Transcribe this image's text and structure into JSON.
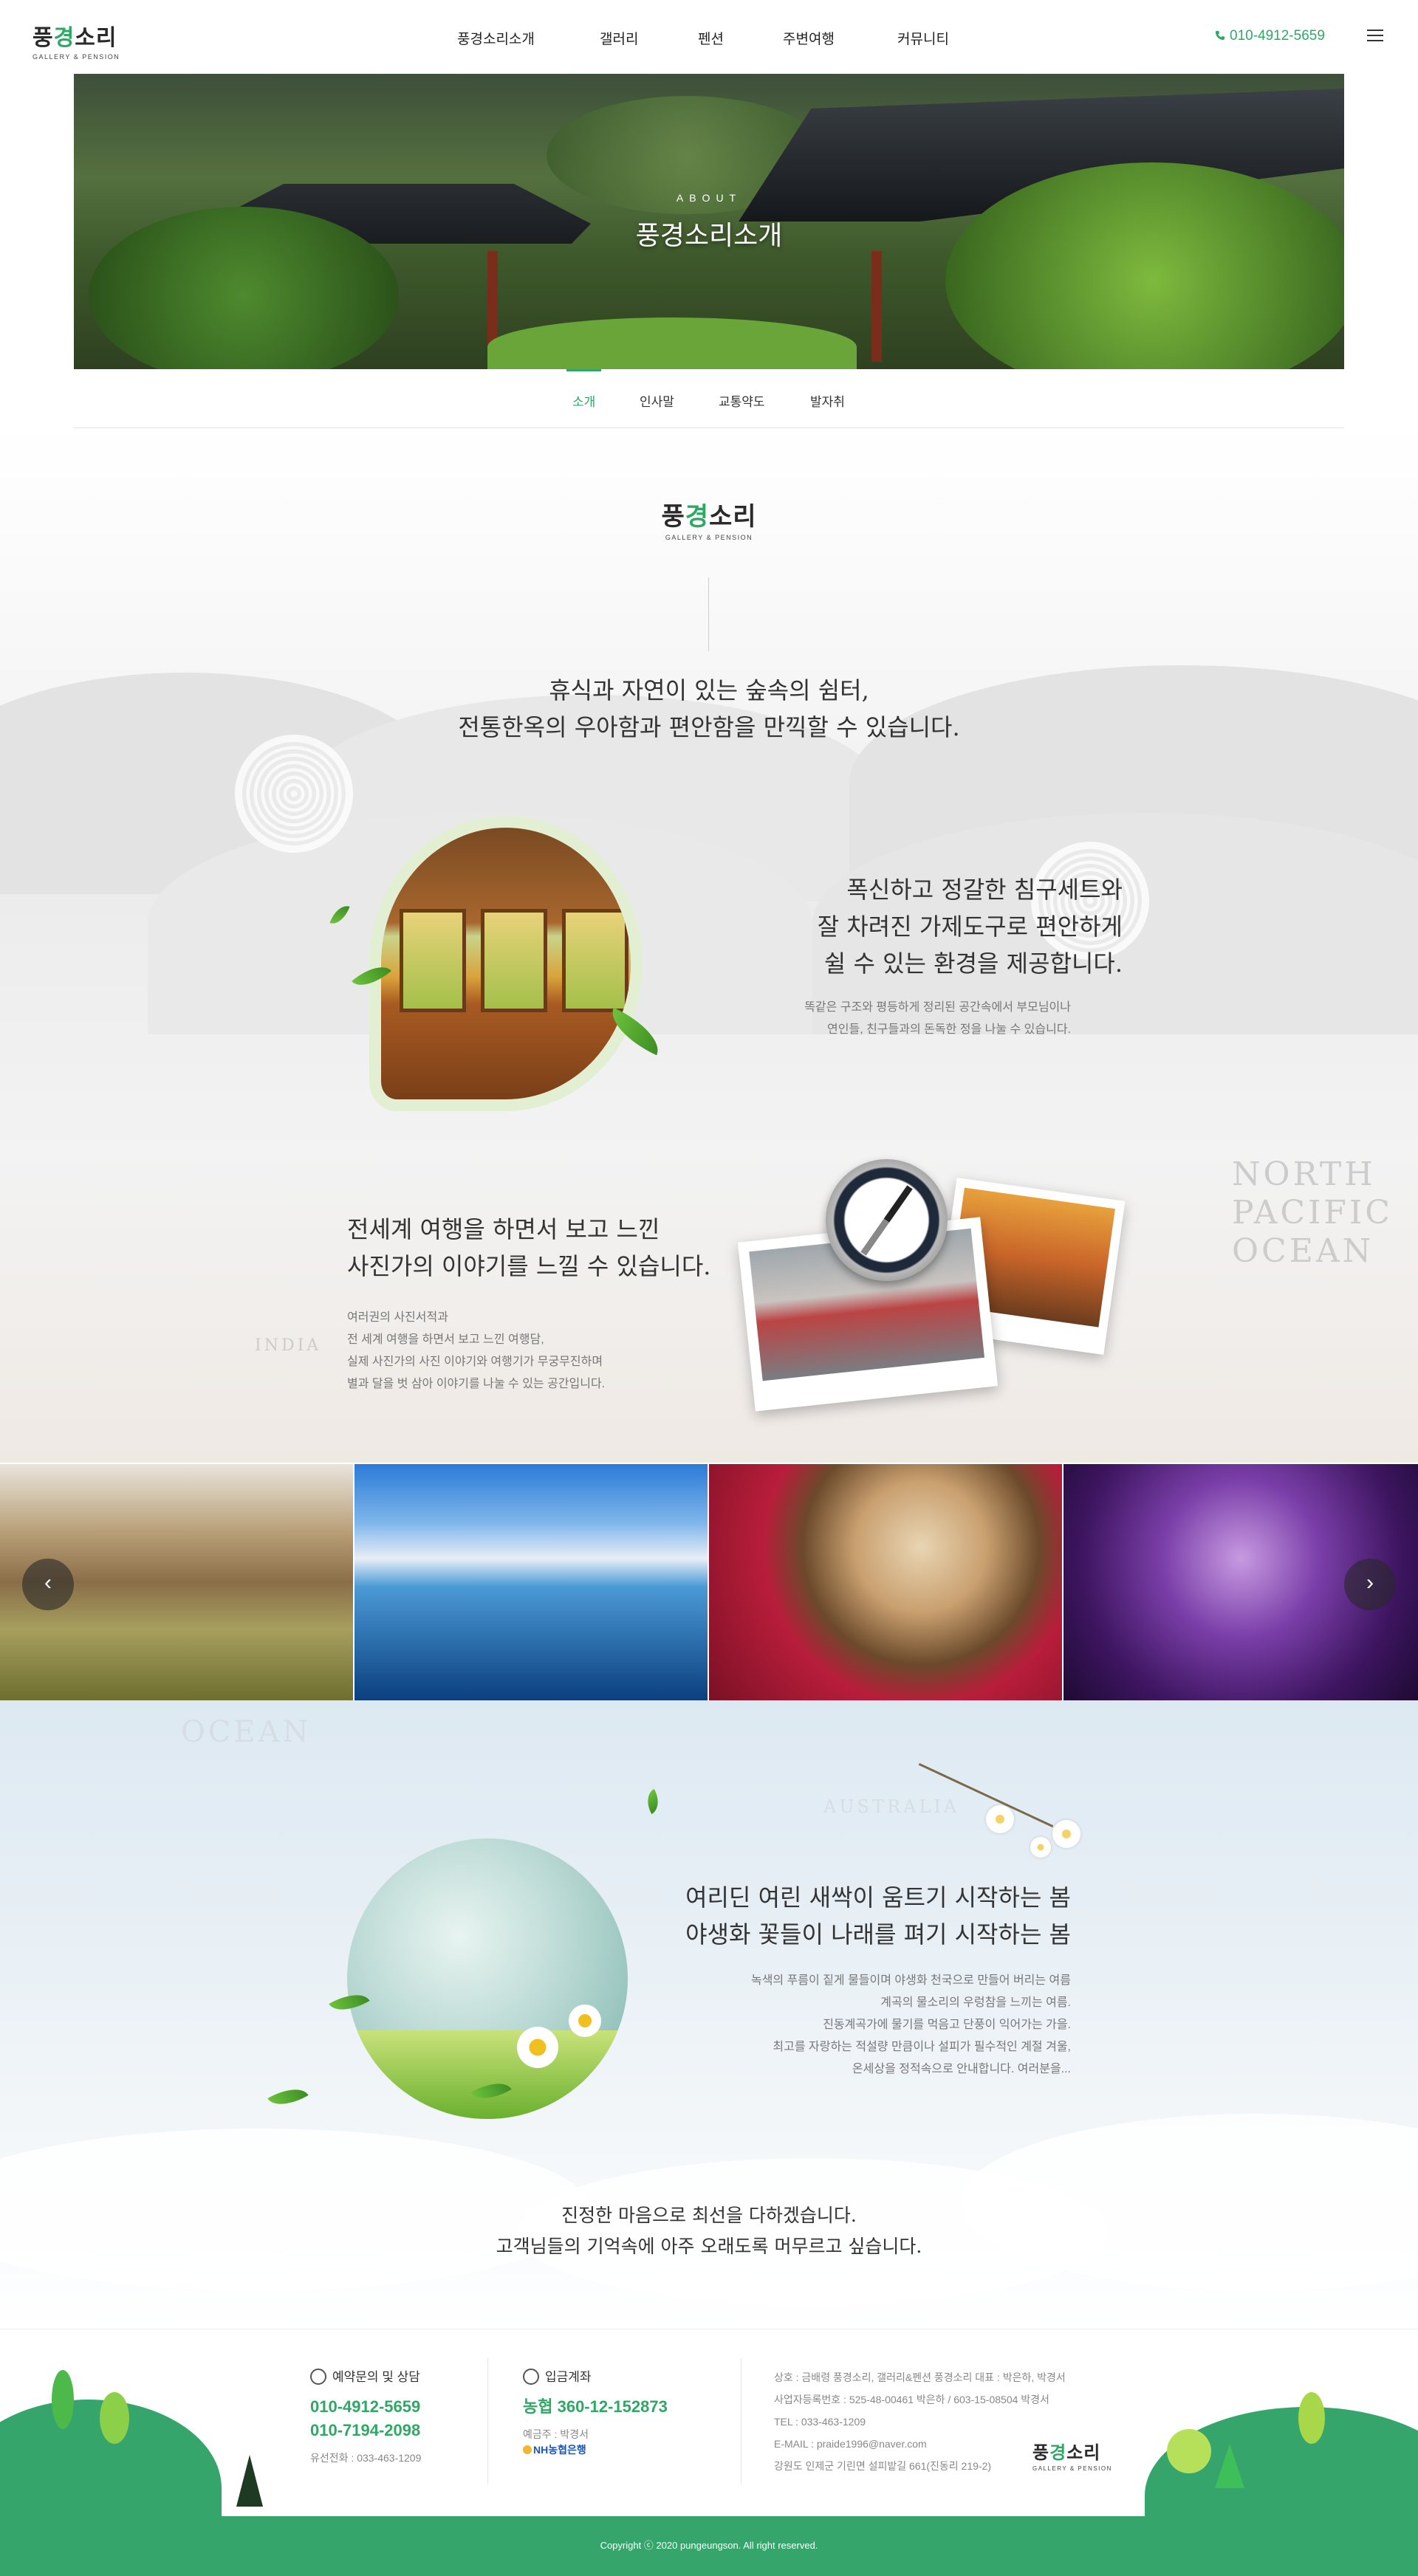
{
  "brand": {
    "name_part1": "풍",
    "name_part2": "경",
    "name_part3": "소리",
    "tagline": "GALLERY & PENSION"
  },
  "nav": {
    "items": [
      "풍경소리소개",
      "갤러리",
      "펜션",
      "주변여행",
      "커뮤니티"
    ],
    "phone": "010-4912-5659"
  },
  "hero": {
    "subtitle": "ABOUT",
    "title": "풍경소리소개"
  },
  "subnav": {
    "items": [
      "소개",
      "인사말",
      "교통약도",
      "발자취"
    ],
    "active": 0
  },
  "intro": {
    "line1": "휴식과 자연이 있는 숲속의 쉼터,",
    "line2": "전통한옥의 우아함과 편안함을 만끽할 수 있습니다."
  },
  "feature1": {
    "title_line1": "폭신하고 정갈한 침구세트와",
    "title_line2": "잘 차려진 가제도구로 편안하게",
    "title_line3": "쉴 수 있는 환경을 제공합니다.",
    "desc_line1": "똑같은 구조와 평등하게 정리된 공간속에서 부모님이나",
    "desc_line2": "연인들, 친구들과의 돈독한 정을 나눌 수 있습니다."
  },
  "feature2": {
    "title_line1": "전세계 여행을 하면서 보고 느낀",
    "title_line2": "사진가의 이야기를 느낄 수 있습니다.",
    "desc_line1": "여러권의 사진서적과",
    "desc_line2": "전 세계 여행을 하면서 보고 느낀 여행담,",
    "desc_line3": "실제 사진가의 사진 이야기와 여행기가 무궁무진하며",
    "desc_line4": "별과 달을 벗 삼아 이야기를 나눌 수 있는 공간입니다."
  },
  "map_labels": {
    "north": "NORTH",
    "pacific": "PACIFIC",
    "ocean": "OCEAN",
    "india": "INDIA",
    "ocean2": "OCEAN",
    "australia": "AUSTRALIA"
  },
  "gallery": {
    "prev": "‹",
    "next": "›"
  },
  "spring": {
    "title_line1": "여리딘 여린 새싹이 움트기 시작하는 봄",
    "title_line2": "야생화 꽃들이 나래를 펴기 시작하는 봄",
    "desc_line1": "녹색의 푸름이 짙게 물들이며 야생화 천국으로 만들어 버리는 여름",
    "desc_line2": "계곡의 물소리의 우렁참을 느끼는 여름.",
    "desc_line3": "진동계곡가에 물기를 먹음고 단풍이 익어가는 가을.",
    "desc_line4": "최고를 자랑하는 적설량 만큼이나 설피가 필수적인 계절 겨울,",
    "desc_line5": "온세상을 정적속으로 안내합니다. 여러분을..."
  },
  "closing": {
    "line1": "진정한 마음으로 최선을 다하겠습니다.",
    "line2": "고객님들의 기억속에 아주 오래도록 머무르고 싶습니다."
  },
  "footer": {
    "reserve_title": "예약문의 및 상담",
    "phone1": "010-4912-5659",
    "phone2": "010-7194-2098",
    "landline": "유선전화 : 033-463-1209",
    "bank_title": "입금계좌",
    "bank_account": "농협 360-12-152873",
    "depositor": "예금주 : 박경서",
    "bank_logo": "NH농협은행",
    "biz_line1": "상호 : 금배령 풍경소리, 갤러리&펜션 풍경소리    대표 : 박은하, 박경서",
    "biz_line2": "사업자등록번호 : 525-48-00461 박은하  /  603-15-08504 박경서",
    "biz_line3": "TEL : 033-463-1209",
    "biz_line4": "E-MAIL : praide1996@naver.com",
    "biz_line5": "강원도 인제군 기린면 설피밭길 661(진동리 219-2)",
    "copyright": "Copyright ⓒ 2020 pungeungson. All right reserved."
  },
  "colors": {
    "accent": "#2fa866",
    "footer_green": "#35a56b",
    "text": "#333333",
    "muted": "#777777"
  }
}
